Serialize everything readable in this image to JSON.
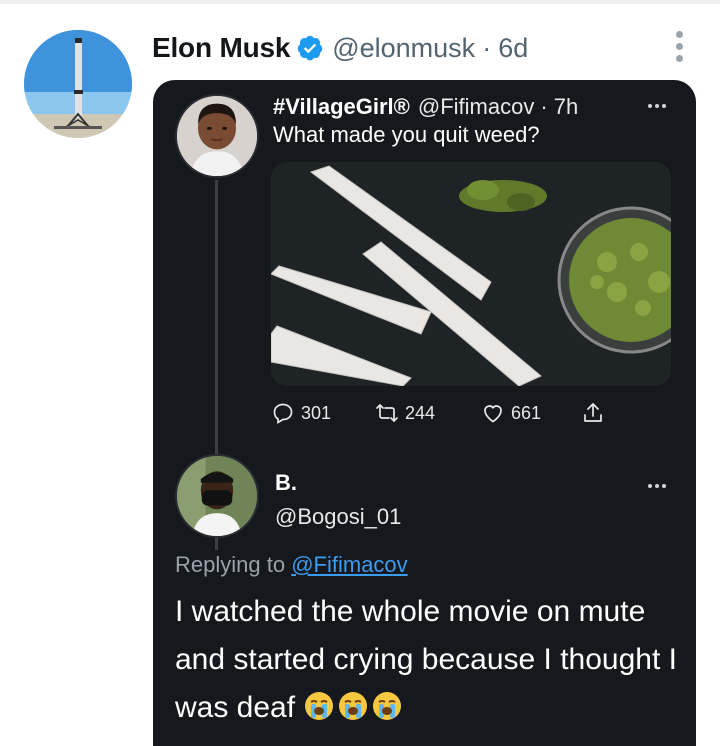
{
  "tweet": {
    "author_name": "Elon Musk",
    "author_handle": "@elonmusk",
    "separator": "·",
    "time": "6d",
    "avatar_icon": "rocket-avatar",
    "verified_icon": "verified-badge-icon",
    "more_icon": "more-vertical-icon"
  },
  "embed": {
    "quoted": {
      "name": "#VillageGirl®",
      "handle": "@Fifimacov",
      "time": "· 7h",
      "text": "What made you quit weed?",
      "actions": {
        "replies": "301",
        "retweets": "244",
        "likes": "661"
      }
    },
    "reply": {
      "name": "B.",
      "handle": "@Bogosi_01",
      "replying_prefix": "Replying to",
      "replying_to": "@Fifimacov",
      "text": "I watched the whole movie on mute and started crying because I thought I was deaf",
      "emoji_icon": "loudly-crying-face-emoji"
    }
  },
  "colors": {
    "embed_bg": "#15181c",
    "link_blue": "#3b9cf0",
    "verified_blue": "#1d9bf0"
  }
}
